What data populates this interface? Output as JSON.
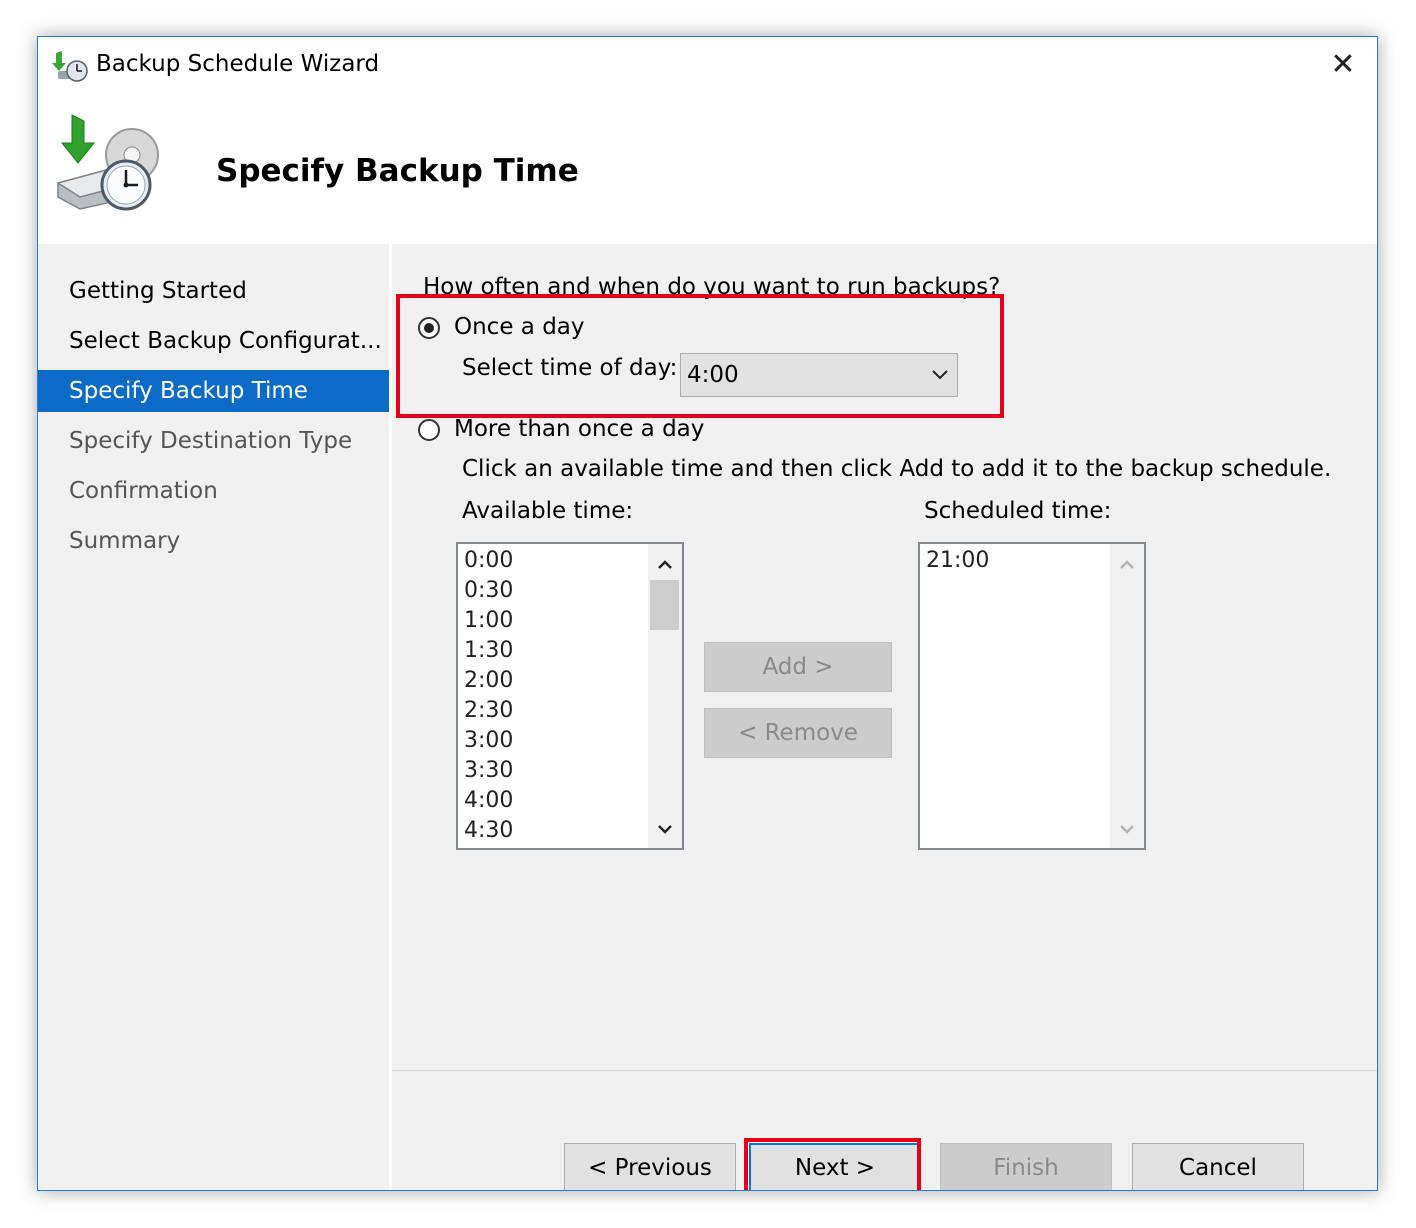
{
  "window": {
    "title": "Backup Schedule Wizard",
    "close_glyph": "✕",
    "app_icon": "backup-wizard-icon",
    "header_icon": "backup-clock-drive-icon"
  },
  "header": {
    "page_title": "Specify Backup Time"
  },
  "sidebar": {
    "items": [
      {
        "label": "Getting Started",
        "state": "done"
      },
      {
        "label": "Select Backup Configurat...",
        "state": "done"
      },
      {
        "label": "Specify Backup Time",
        "state": "active"
      },
      {
        "label": "Specify Destination Type",
        "state": "todo"
      },
      {
        "label": "Confirmation",
        "state": "todo"
      },
      {
        "label": "Summary",
        "state": "todo"
      }
    ]
  },
  "main": {
    "question": "How often and when do you want to run backups?",
    "once": {
      "label": "Once a day",
      "checked": true,
      "time_label": "Select time of day:",
      "time_value": "4:00"
    },
    "more": {
      "label": "More than once a day",
      "checked": false,
      "instruction": "Click an available time and then click Add to add it to the backup schedule."
    },
    "available": {
      "label": "Available time:",
      "items": [
        "0:00",
        "0:30",
        "1:00",
        "1:30",
        "2:00",
        "2:30",
        "3:00",
        "3:30",
        "4:00",
        "4:30"
      ]
    },
    "scheduled": {
      "label": "Scheduled time:",
      "items": [
        "21:00"
      ]
    },
    "add_label": "Add >",
    "remove_label": "< Remove"
  },
  "footer": {
    "previous": "< Previous",
    "next": "Next >",
    "finish": "Finish",
    "cancel": "Cancel"
  },
  "colors": {
    "accent": "#0b6bc6",
    "highlight": "#e2001a",
    "panel": "#f0f0f0"
  }
}
